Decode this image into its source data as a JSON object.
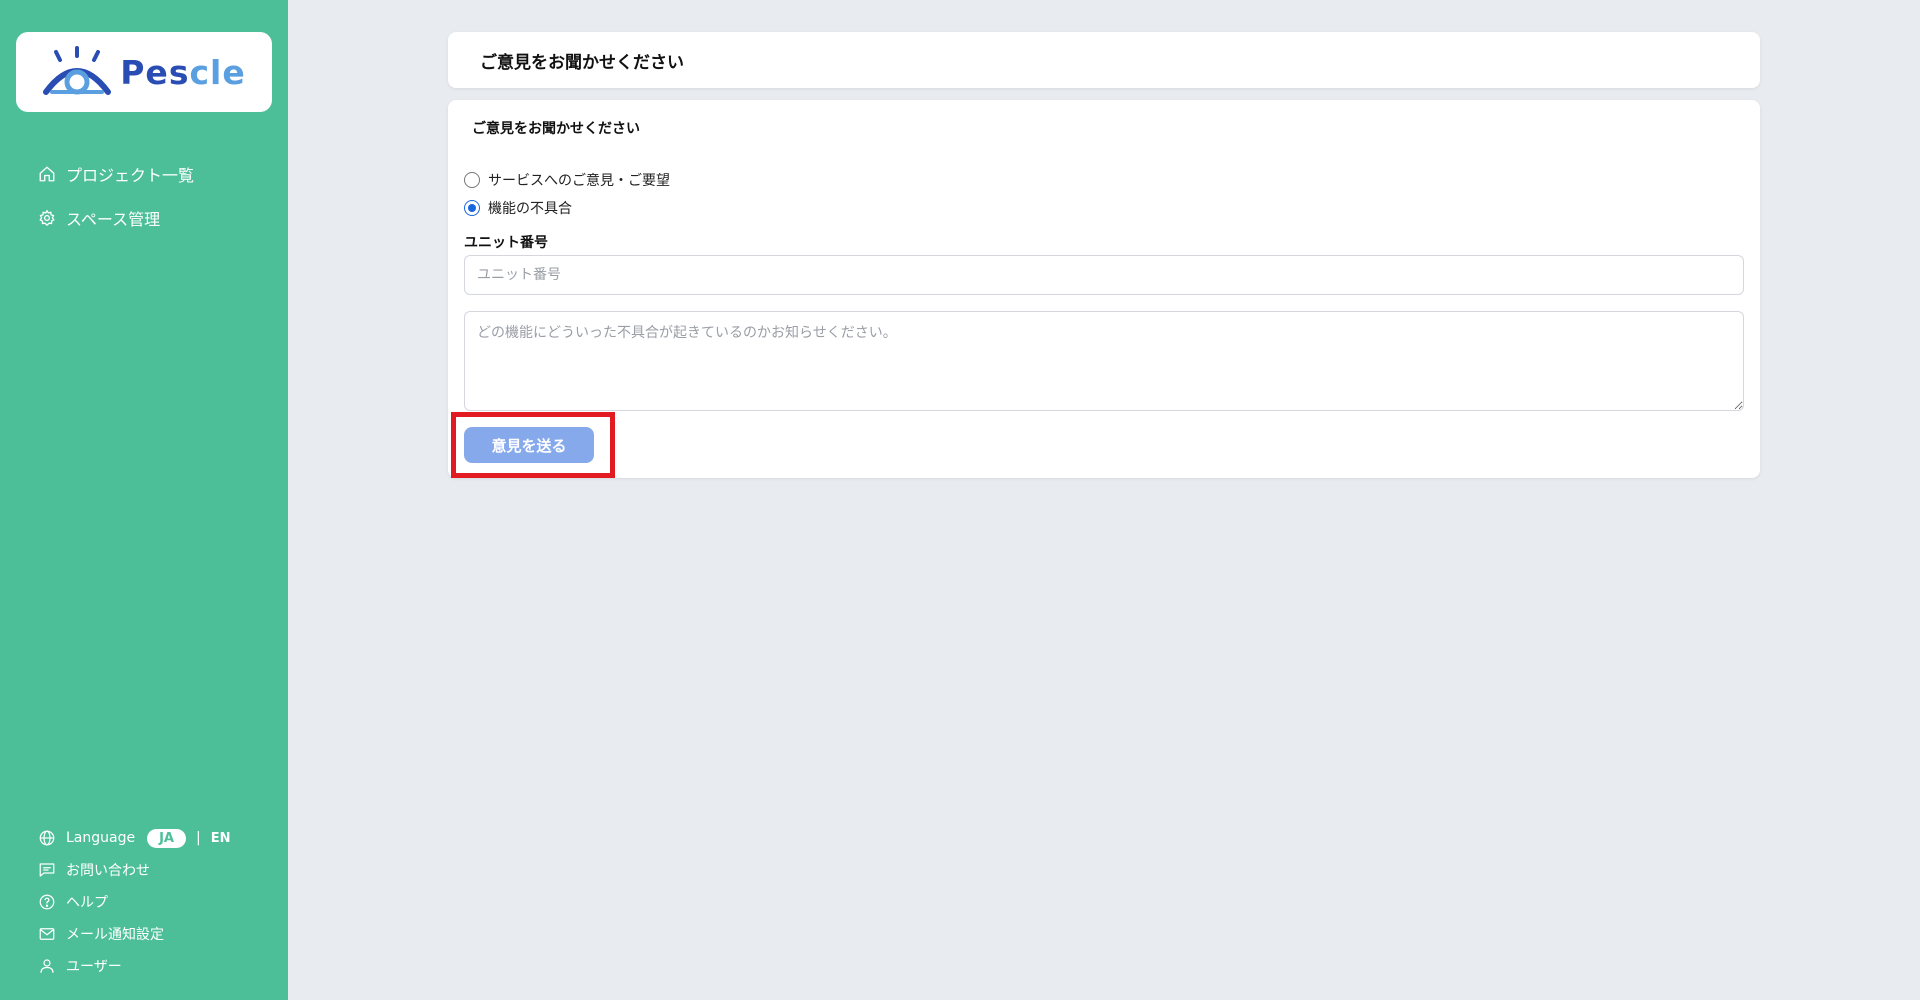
{
  "brand": {
    "name_part1": "Pes",
    "name_part2": "cle"
  },
  "sidebar": {
    "nav": [
      {
        "label": "プロジェクト一覧",
        "icon": "home-icon"
      },
      {
        "label": "スペース管理",
        "icon": "gear-icon"
      }
    ],
    "language": {
      "label": "Language",
      "active": "JA",
      "separator": "|",
      "other": "EN"
    },
    "bottom": [
      {
        "label": "お問い合わせ",
        "icon": "chat-icon"
      },
      {
        "label": "ヘルプ",
        "icon": "help-icon"
      },
      {
        "label": "メール通知設定",
        "icon": "mail-icon"
      },
      {
        "label": "ユーザー",
        "icon": "user-icon"
      }
    ]
  },
  "header": {
    "title": "ご意見をお聞かせください"
  },
  "form": {
    "title": "ご意見をお聞かせください",
    "options": [
      {
        "label": "サービスへのご意見・ご要望",
        "checked": false
      },
      {
        "label": "機能の不具合",
        "checked": true
      }
    ],
    "unit_label": "ユニット番号",
    "unit_placeholder": "ユニット番号",
    "detail_placeholder": "どの機能にどういった不具合が起きているのかお知らせください。",
    "submit_label": "意見を送る"
  },
  "colors": {
    "sidebar": "#4dbf98",
    "background": "#e8ebf0",
    "submit": "#86a9ec",
    "highlight": "#e21b23",
    "radio_checked": "#1a66e0"
  }
}
